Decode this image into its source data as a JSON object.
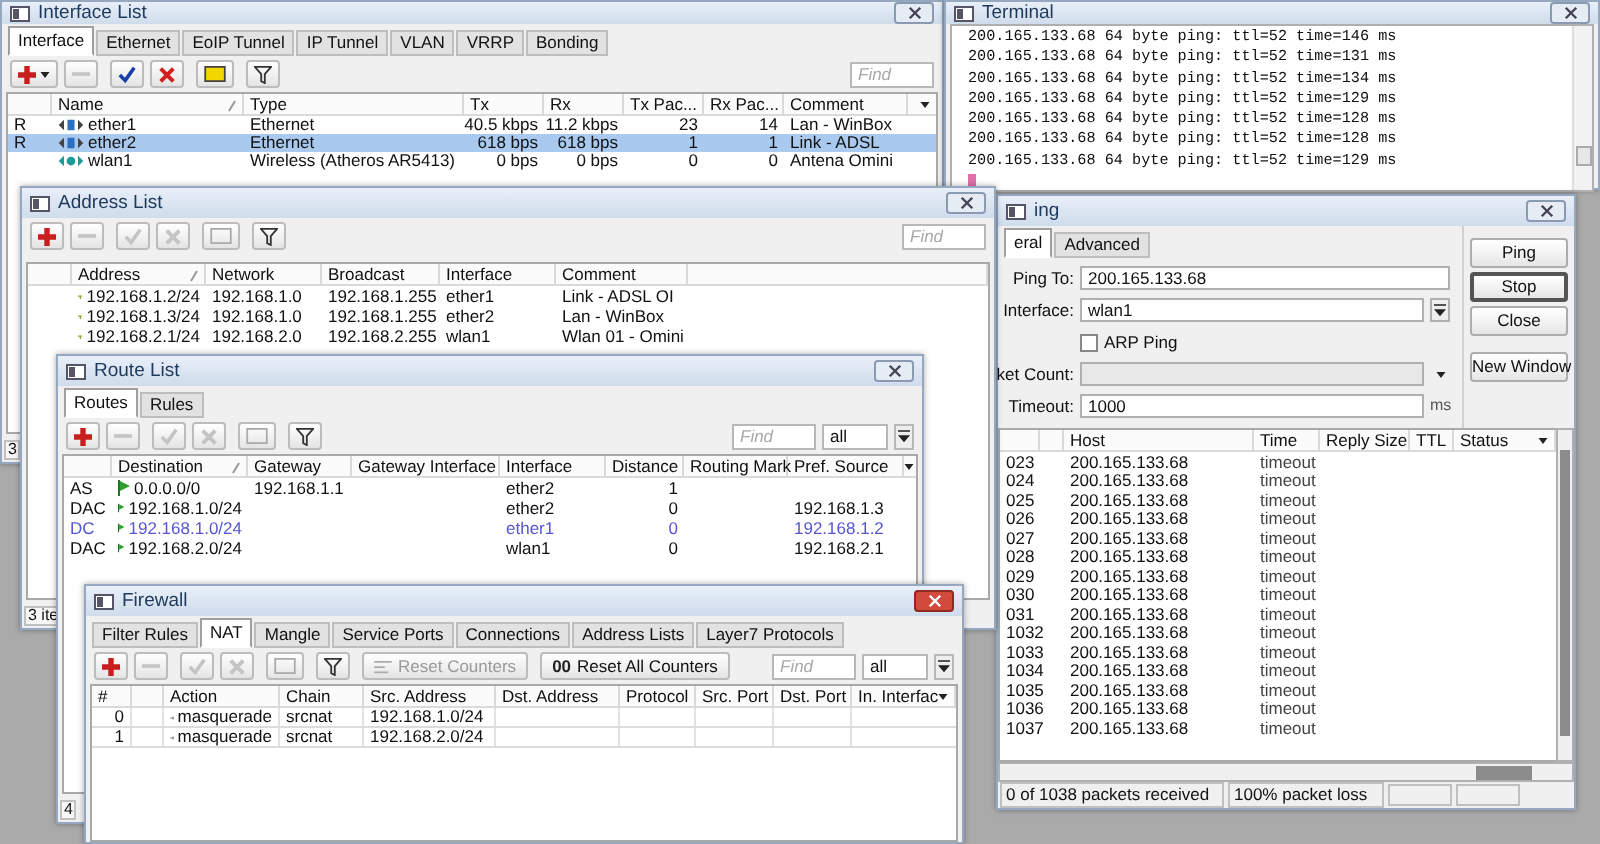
{
  "interface_list": {
    "title": "Interface List",
    "active": false,
    "tabs": [
      {
        "label": "Interface",
        "selected": true
      },
      {
        "label": "Ethernet",
        "selected": false
      },
      {
        "label": "EoIP Tunnel",
        "selected": false
      },
      {
        "label": "IP Tunnel",
        "selected": false
      },
      {
        "label": "VLAN",
        "selected": false
      },
      {
        "label": "VRRP",
        "selected": false
      },
      {
        "label": "Bonding",
        "selected": false
      }
    ],
    "toolbar": [
      {
        "kind": "add",
        "disabled": false,
        "menu": true
      },
      {
        "kind": "remove",
        "disabled": true
      },
      {
        "kind": "enable",
        "disabled": false
      },
      {
        "kind": "disable",
        "disabled": false
      },
      {
        "kind": "comment",
        "disabled": false
      },
      {
        "kind": "filter",
        "disabled": false
      }
    ],
    "find": {
      "placeholder": "Find"
    },
    "columns": [
      "Name",
      "Type",
      "Tx",
      "Rx",
      "Tx Pac...",
      "Rx Pac...",
      "Comment"
    ],
    "rows": [
      {
        "flags": "R",
        "kind": "ethernet",
        "name": "ether1",
        "type": "Ethernet",
        "tx": "40.5 kbps",
        "rx": "11.2 kbps",
        "tx_packets": "23",
        "rx_packets": "14",
        "comment": "Lan - WinBox",
        "selected": false
      },
      {
        "flags": "R",
        "kind": "ethernet",
        "name": "ether2",
        "type": "Ethernet",
        "tx": "618 bps",
        "rx": "618 bps",
        "tx_packets": "1",
        "rx_packets": "1",
        "comment": "Link - ADSL",
        "selected": true
      },
      {
        "kind": "wireless",
        "name": "wlan1",
        "type": "Wireless (Atheros AR5413)",
        "tx": "0 bps",
        "rx": "0 bps",
        "tx_packets": "0",
        "rx_packets": "0",
        "comment": "Antena Omini",
        "selected": false
      }
    ],
    "status": "3"
  },
  "terminal": {
    "title": "Terminal",
    "active": false,
    "lines": [
      "200.165.133.68 64 byte ping: ttl=52 time=146 ms",
      "200.165.133.68 64 byte ping: ttl=52 time=131 ms",
      "200.165.133.68 64 byte ping: ttl=52 time=134 ms",
      "200.165.133.68 64 byte ping: ttl=52 time=129 ms",
      "200.165.133.68 64 byte ping: ttl=52 time=128 ms",
      "200.165.133.68 64 byte ping: ttl=52 time=128 ms",
      "200.165.133.68 64 byte ping: ttl=52 time=129 ms"
    ]
  },
  "ping": {
    "title": "ing",
    "active": false,
    "tabs": [
      {
        "label": "eral",
        "selected": true
      },
      {
        "label": "Advanced",
        "selected": false
      }
    ],
    "fields": [
      {
        "kind": "text",
        "label": "Ping To:",
        "value": "200.165.133.68"
      },
      {
        "kind": "select",
        "label": "Interface:",
        "value": "wlan1"
      },
      {
        "kind": "checkbox",
        "label": "ARP Ping",
        "checked": false
      },
      {
        "kind": "combo",
        "label": "ket Count:",
        "disabled": true
      },
      {
        "kind": "unit",
        "label": "Timeout:",
        "value": "1000",
        "unit": "ms"
      }
    ],
    "buttons": [
      {
        "label": "Ping",
        "focused": false
      },
      {
        "label": "Stop",
        "focused": true
      },
      {
        "label": "Close",
        "focused": false
      },
      {
        "label": "New Window",
        "focused": false
      }
    ],
    "columns": [
      "Host",
      "Time",
      "Reply Size",
      "TTL",
      "Status"
    ],
    "rows": [
      {
        "number": "023",
        "host": "200.165.133.68",
        "time": "timeout"
      },
      {
        "number": "024",
        "host": "200.165.133.68",
        "time": "timeout"
      },
      {
        "number": "025",
        "host": "200.165.133.68",
        "time": "timeout"
      },
      {
        "number": "026",
        "host": "200.165.133.68",
        "time": "timeout"
      },
      {
        "number": "027",
        "host": "200.165.133.68",
        "time": "timeout"
      },
      {
        "number": "028",
        "host": "200.165.133.68",
        "time": "timeout"
      },
      {
        "number": "029",
        "host": "200.165.133.68",
        "time": "timeout"
      },
      {
        "number": "030",
        "host": "200.165.133.68",
        "time": "timeout"
      },
      {
        "number": "031",
        "host": "200.165.133.68",
        "time": "timeout"
      },
      {
        "number": "1032",
        "host": "200.165.133.68",
        "time": "timeout"
      },
      {
        "number": "1033",
        "host": "200.165.133.68",
        "time": "timeout"
      },
      {
        "number": "1034",
        "host": "200.165.133.68",
        "time": "timeout"
      },
      {
        "number": "1035",
        "host": "200.165.133.68",
        "time": "timeout"
      },
      {
        "number": "1036",
        "host": "200.165.133.68",
        "time": "timeout"
      },
      {
        "number": "1037",
        "host": "200.165.133.68",
        "time": "timeout"
      }
    ],
    "status": [
      "0 of 1038 packets received",
      "100% packet loss"
    ]
  },
  "address_list": {
    "title": "Address List",
    "active": false,
    "toolbar": [
      {
        "kind": "add",
        "disabled": false
      },
      {
        "kind": "remove",
        "disabled": true
      },
      {
        "kind": "enable",
        "disabled": true
      },
      {
        "kind": "disable",
        "disabled": true
      },
      {
        "kind": "comment",
        "disabled": true
      },
      {
        "kind": "filter",
        "disabled": false
      }
    ],
    "find": {
      "placeholder": "Find"
    },
    "columns": [
      "Address",
      "Network",
      "Broadcast",
      "Interface",
      "Comment"
    ],
    "rows": [
      {
        "address": "192.168.1.2/24",
        "network": "192.168.1.0",
        "broadcast": "192.168.1.255",
        "interface": "ether1",
        "comment": "Link - ADSL OI"
      },
      {
        "address": "192.168.1.3/24",
        "network": "192.168.1.0",
        "broadcast": "192.168.1.255",
        "interface": "ether2",
        "comment": "Lan - WinBox"
      },
      {
        "address": "192.168.2.1/24",
        "network": "192.168.2.0",
        "broadcast": "192.168.2.255",
        "interface": "wlan1",
        "comment": "Wlan 01 - Omini"
      }
    ],
    "status": "3 ite"
  },
  "route_list": {
    "title": "Route List",
    "active": false,
    "tabs": [
      {
        "label": "Routes",
        "selected": true
      },
      {
        "label": "Rules",
        "selected": false
      }
    ],
    "toolbar": [
      {
        "kind": "add",
        "disabled": false
      },
      {
        "kind": "remove",
        "disabled": true
      },
      {
        "kind": "enable",
        "disabled": true
      },
      {
        "kind": "disable",
        "disabled": true
      },
      {
        "kind": "comment",
        "disabled": true
      },
      {
        "kind": "filter",
        "disabled": false
      }
    ],
    "find": {
      "placeholder": "Find"
    },
    "filter_value": "all",
    "columns": [
      "Destination",
      "Gateway",
      "Gateway Interface",
      "Interface",
      "Distance",
      "Routing Mark",
      "Pref. Source"
    ],
    "rows": [
      {
        "flags": "AS",
        "destination": "0.0.0.0/0",
        "gateway": "192.168.1.1",
        "interface": "ether2",
        "distance": "1",
        "active": true
      },
      {
        "flags": "DAC",
        "destination": "192.168.1.0/24",
        "interface": "ether2",
        "distance": "0",
        "pref_source": "192.168.1.3",
        "active": true
      },
      {
        "flags": "DC",
        "destination": "192.168.1.0/24",
        "interface": "ether1",
        "distance": "0",
        "pref_source": "192.168.1.2",
        "active": false
      },
      {
        "flags": "DAC",
        "destination": "192.168.2.0/24",
        "interface": "wlan1",
        "distance": "0",
        "pref_source": "192.168.2.1",
        "active": true
      }
    ],
    "status": "4"
  },
  "firewall": {
    "title": "Firewall",
    "active": true,
    "tabs": [
      {
        "label": "Filter Rules",
        "selected": false
      },
      {
        "label": "NAT",
        "selected": true
      },
      {
        "label": "Mangle",
        "selected": false
      },
      {
        "label": "Service Ports",
        "selected": false
      },
      {
        "label": "Connections",
        "selected": false
      },
      {
        "label": "Address Lists",
        "selected": false
      },
      {
        "label": "Layer7 Protocols",
        "selected": false
      }
    ],
    "toolbar": [
      {
        "kind": "add",
        "disabled": false
      },
      {
        "kind": "remove",
        "disabled": true
      },
      {
        "kind": "enable",
        "disabled": true
      },
      {
        "kind": "disable",
        "disabled": true
      },
      {
        "kind": "comment",
        "disabled": true
      },
      {
        "kind": "filter",
        "disabled": false
      }
    ],
    "counter_buttons": [
      {
        "label": "Reset Counters",
        "disabled": true
      },
      {
        "label": "Reset All Counters",
        "glyph": "00",
        "disabled": false
      }
    ],
    "find": {
      "placeholder": "Find"
    },
    "filter_value": "all",
    "columns": [
      "#",
      "Action",
      "Chain",
      "Src. Address",
      "Dst. Address",
      "Protocol",
      "Src. Port",
      "Dst. Port",
      "In. Interfac"
    ],
    "rows": [
      {
        "number": "0",
        "action": "masquerade",
        "chain": "srcnat",
        "src_address": "192.168.1.0/24"
      },
      {
        "number": "1",
        "action": "masquerade",
        "chain": "srcnat",
        "src_address": "192.168.2.0/24"
      }
    ]
  }
}
